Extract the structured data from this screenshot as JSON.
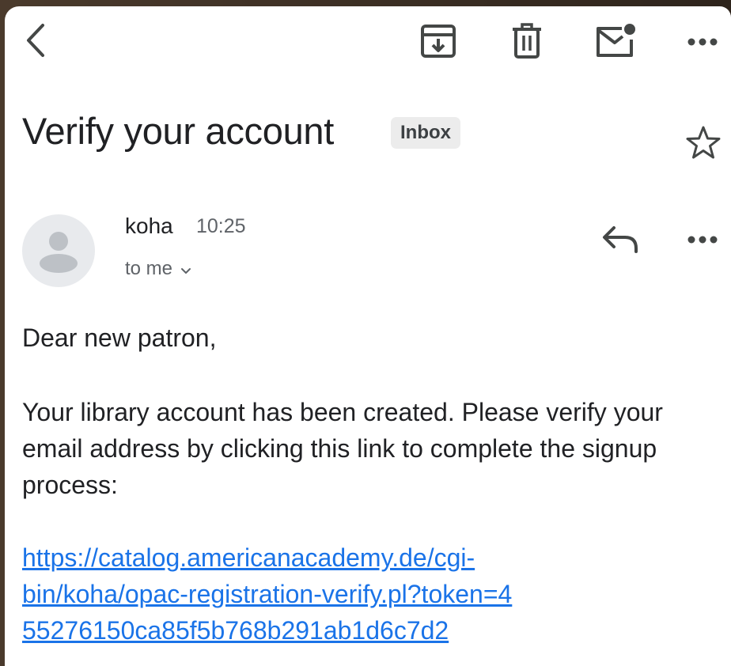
{
  "toolbar": {
    "back_icon": "chevron-left-icon",
    "archive_icon": "archive-icon",
    "delete_icon": "trash-icon",
    "unread_icon": "mark-unread-icon",
    "more_icon": "more-horizontal-icon"
  },
  "email": {
    "subject": "Verify your account",
    "label": "Inbox",
    "star_icon": "star-outline-icon",
    "sender": {
      "name": "koha",
      "time": "10:25",
      "recipient": "to me",
      "avatar_icon": "person-avatar-icon"
    },
    "actions": {
      "reply_icon": "reply-icon",
      "more_icon": "more-horizontal-icon"
    },
    "body": {
      "greeting": "Dear new patron,",
      "paragraph": "Your library account has been created. Please verify your email address by clicking this link to complete the signup process:",
      "link_line_1": "https://catalog.americanacademy.de/cgi-",
      "link_line_2": "bin/koha/opac-registration-verify.pl?token=4",
      "link_line_3": "55276150ca85f5b768b291ab1d6c7d2"
    }
  },
  "colors": {
    "link": "#1a73e8",
    "text": "#202124",
    "secondary_text": "#5f6368",
    "chip_bg": "#ececec",
    "icon": "#444746"
  }
}
